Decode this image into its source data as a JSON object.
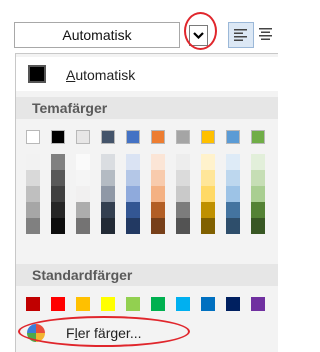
{
  "toolbar": {
    "font_color_value": "Automatisk",
    "dropdown_icon": "chevron-down-icon",
    "align_left_icon": "align-left-icon",
    "align_center_icon": "align-center-icon"
  },
  "menu": {
    "automatic_label": "Automatisk",
    "theme_section_title": "Temafärger",
    "theme_colors": [
      "#ffffff",
      "#000000",
      "#e7e6e6",
      "#44546a",
      "#4472c4",
      "#ed7d31",
      "#a5a5a5",
      "#ffc000",
      "#5b9bd5",
      "#70ad47"
    ],
    "standard_section_title": "Standardfärger",
    "standard_colors": [
      "#c00000",
      "#ff0000",
      "#ffc000",
      "#ffff00",
      "#92d050",
      "#00b050",
      "#00b0f0",
      "#0070c0",
      "#002060",
      "#7030a0"
    ],
    "more_colors_label": "Fler färger...",
    "more_colors_icon": "color-wheel-icon"
  },
  "annotation_color": "#e0262c"
}
